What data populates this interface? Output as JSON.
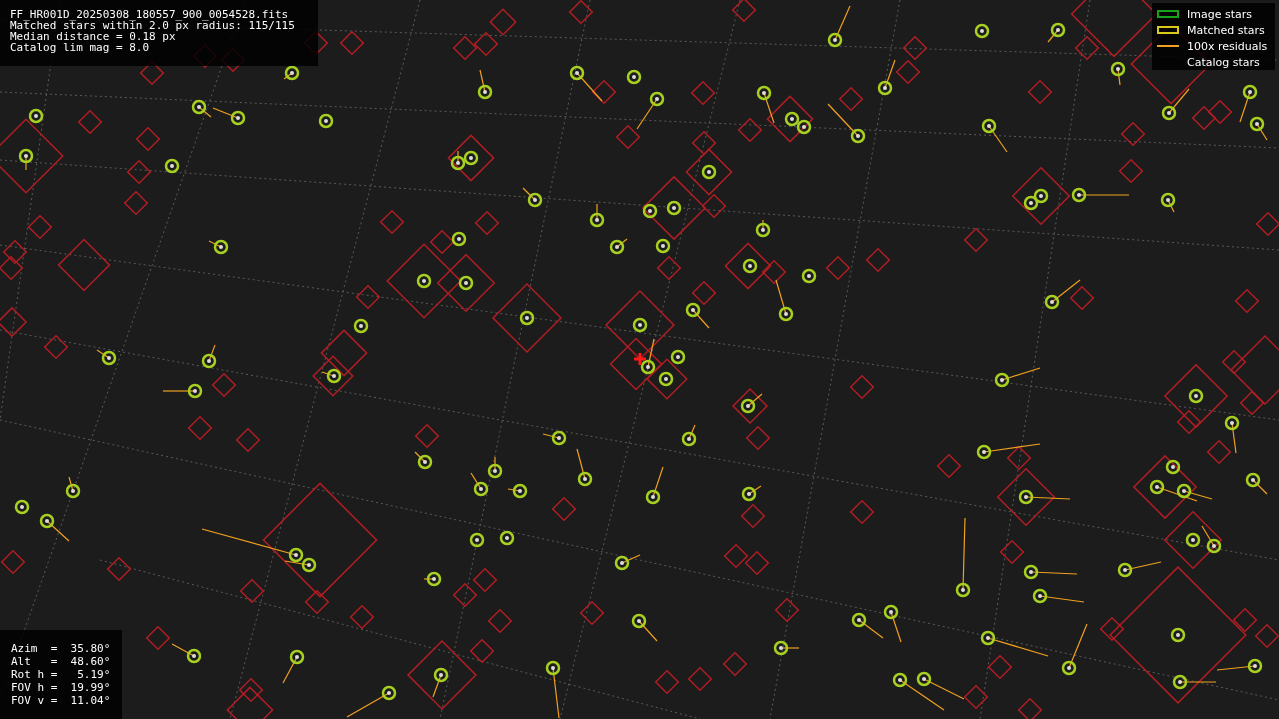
{
  "info_lines": [
    "FF_HR001D_20250308_180557_900_0054528.fits",
    "Matched stars within 2.0 px radius: 115/115",
    "Median distance = 0.18 px",
    "Catalog lim mag = 8.0"
  ],
  "legend": [
    {
      "kind": "image",
      "label": "Image stars"
    },
    {
      "kind": "matched",
      "label": "Matched stars"
    },
    {
      "kind": "residual",
      "label": "100x residuals"
    },
    {
      "kind": "catalog",
      "label": "Catalog stars"
    }
  ],
  "readouts": [
    "Azim  =  35.80°",
    "Alt   =  48.60°",
    "Rot h =   5.19°",
    "FOV h =  19.99°",
    "FOV v =  11.04°"
  ]
}
